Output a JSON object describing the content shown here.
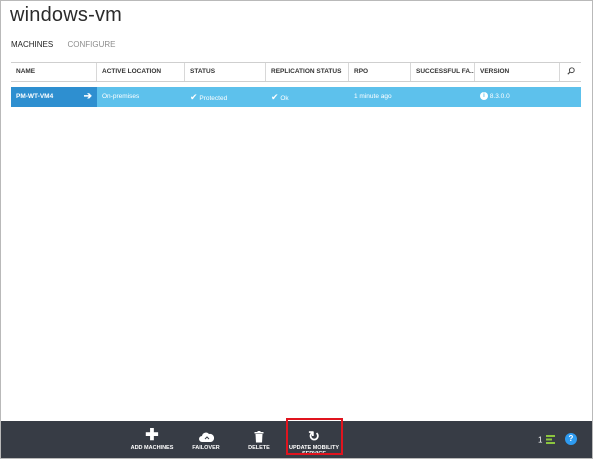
{
  "page": {
    "title": "windows-vm"
  },
  "tabs": [
    {
      "label": "MACHINES",
      "active": true
    },
    {
      "label": "CONFIGURE",
      "active": false
    }
  ],
  "columns": [
    "NAME",
    "ACTIVE LOCATION",
    "STATUS",
    "REPLICATION STATUS",
    "RPO",
    "SUCCESSFUL FA...",
    "VERSION"
  ],
  "rows": [
    {
      "name": "PM-WT-VM4",
      "active_location": "On-premises",
      "status": "Protected",
      "replication_status": "Ok",
      "rpo": "1 minute ago",
      "successful_failover": "",
      "version": "8.3.0.0"
    }
  ],
  "commands": [
    {
      "label": "ADD MACHINES",
      "icon": "plus-icon"
    },
    {
      "label": "FAILOVER",
      "icon": "cloud-icon"
    },
    {
      "label": "DELETE",
      "icon": "trash-icon"
    },
    {
      "label_line1": "UPDATE MOBILITY",
      "label_line2": "SERVICE",
      "icon": "refresh-icon",
      "highlighted": true
    }
  ],
  "footer": {
    "notification_count": "1",
    "help": "?"
  },
  "colors": {
    "selected_row": "#5dc1ec",
    "name_cell": "#2e8fd0",
    "command_bar": "#373c45",
    "highlight": "#e0141e"
  }
}
